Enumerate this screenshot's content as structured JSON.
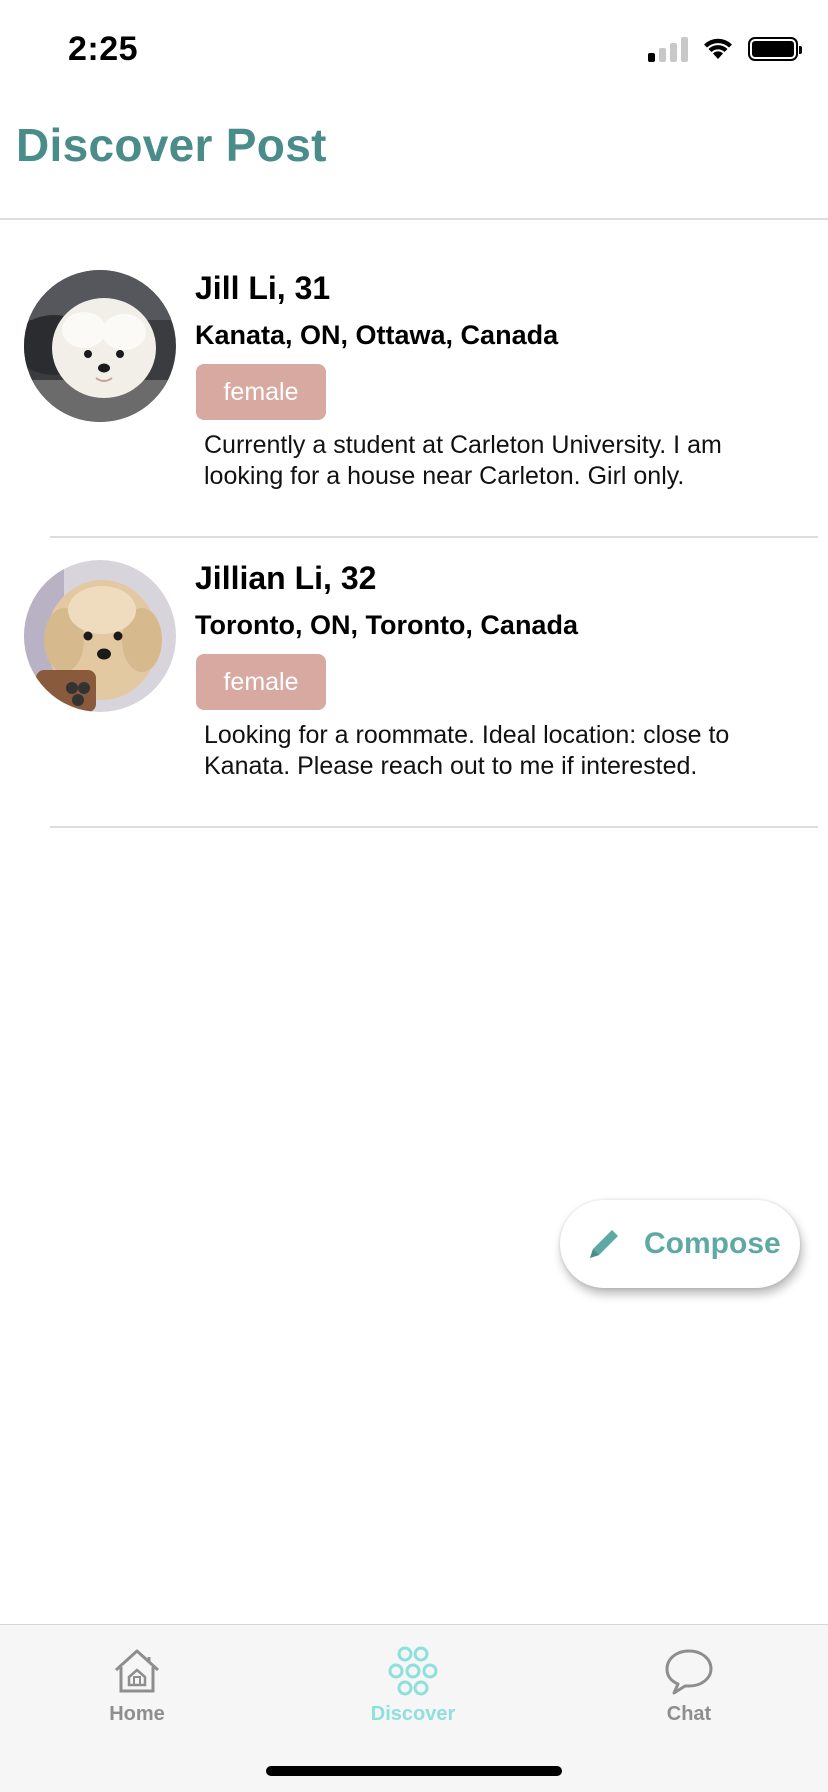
{
  "status_bar": {
    "time": "2:25",
    "signal_bars_active": 1,
    "signal_bars_total": 4
  },
  "header": {
    "title": "Discover Post"
  },
  "posts": [
    {
      "name_age": "Jill Li, 31",
      "location": "Kanata, ON, Ottawa, Canada",
      "gender": "female",
      "description": "Currently a student at Carleton University. I am looking for a house near Carleton. Girl only.",
      "avatar_icon": "white-fluffy-dog-photo"
    },
    {
      "name_age": "Jillian Li, 32",
      "location": "Toronto, ON, Toronto, Canada",
      "gender": "female",
      "description": "Looking for a roommate. Ideal location: close to Kanata. Please reach out to me if interested.",
      "avatar_icon": "cream-poodle-photo"
    }
  ],
  "compose": {
    "label": "Compose",
    "icon": "pencil-icon"
  },
  "tab_bar": {
    "tabs": [
      {
        "label": "Home",
        "icon": "home-icon",
        "active": false
      },
      {
        "label": "Discover",
        "icon": "discover-icon",
        "active": true
      },
      {
        "label": "Chat",
        "icon": "chat-bubble-icon",
        "active": false
      }
    ]
  },
  "colors": {
    "title": "#4a8c8a",
    "badge": "#d8a9a0",
    "compose_text": "#5fa9a4",
    "tab_active": "#8ee0dc",
    "tab_inactive": "#8e8e8e"
  }
}
